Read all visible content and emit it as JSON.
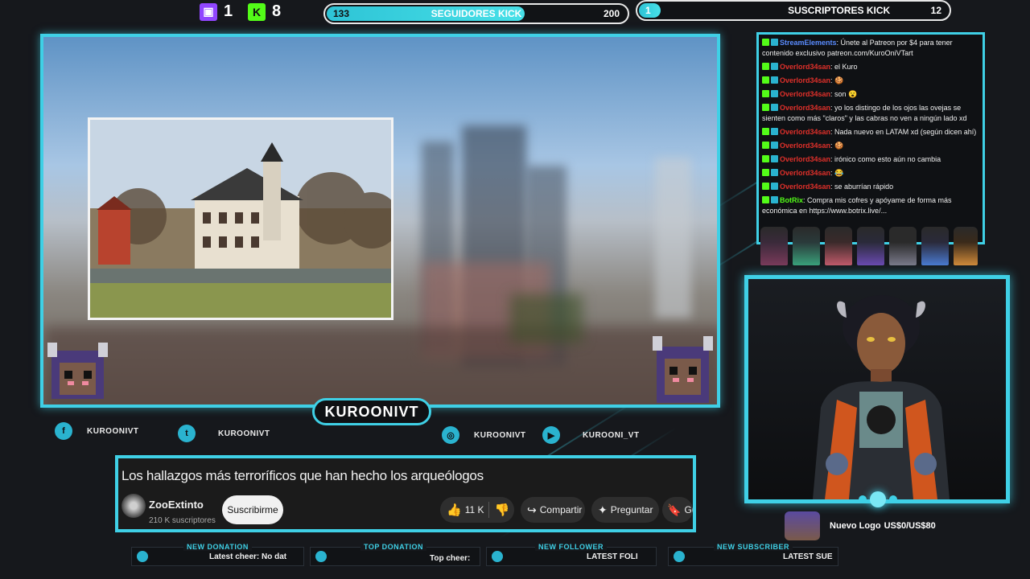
{
  "counters": {
    "twitch_count": "1",
    "kick_count": "8"
  },
  "followers_bar": {
    "current": "133",
    "label": "SEGUIDORES KICK",
    "goal": "200",
    "progress": 0.665
  },
  "subscribers_bar": {
    "current": "1",
    "label": "SUSCRIPTORES KICK",
    "goal": "12",
    "progress": 0.08
  },
  "chat": {
    "messages": [
      {
        "user": "StreamElements",
        "text": ": Únete al Patreon por $4 para tener contenido exclusivo patreon.com/KuroOniVTart"
      },
      {
        "user": "Overlord34san",
        "text": ": el Kuro"
      },
      {
        "user": "Overlord34san",
        "text": ": 🍪"
      },
      {
        "user": "Overlord34san",
        "text": ": son 😮"
      },
      {
        "user": "Overlord34san",
        "text": ": yo los distingo de los ojos las ovejas se sienten como más \"claros\" y las cabras no ven a ningún lado xd"
      },
      {
        "user": "Overlord34san",
        "text": ": Nada nuevo en LATAM xd (según dicen ahí)"
      },
      {
        "user": "Overlord34san",
        "text": ": 🍪"
      },
      {
        "user": "Overlord34san",
        "text": ": irónico como esto aún no cambia"
      },
      {
        "user": "Overlord34san",
        "text": ": 😂"
      },
      {
        "user": "Overlord34san",
        "text": ": se aburrían rápido"
      },
      {
        "user": "BotRix",
        "text": ": Compra mis cofres y apóyame de forma más económica en https://www.botrix.live/..."
      }
    ]
  },
  "nameplate": "KUROONIVT",
  "socials": [
    {
      "icon": "f",
      "label": "KUROONIVT"
    },
    {
      "icon": "t",
      "label": "KUROONIVT"
    },
    {
      "icon": "◎",
      "label": "KUROONIVT"
    },
    {
      "icon": "▶",
      "label": "KUROONI_VT"
    }
  ],
  "video": {
    "title": "Los hallazgos más terroríficos que han hecho los arqueólogos",
    "channel": "ZooExtinto",
    "subscribers": "210 K suscriptores",
    "subscribe_label": "Suscribirme",
    "likes": "11 K",
    "share_label": "Compartir",
    "ask_label": "Preguntar",
    "save_label": "Gu"
  },
  "goal": {
    "label": "Nuevo Logo",
    "amount": "US$0/US$80"
  },
  "alerts": [
    {
      "title": "NEW DONATION",
      "value": "Latest cheer: No dat"
    },
    {
      "title": "TOP DONATION",
      "value": "Top cheer:"
    },
    {
      "title": "NEW FOLLOWER",
      "value": "LATEST FOLI"
    },
    {
      "title": "NEW SUBSCRIBER",
      "value": "LATEST SUE"
    }
  ],
  "colors": {
    "accent": "#3fd0e6",
    "twitch": "#9146ff",
    "kick": "#53fc18"
  }
}
